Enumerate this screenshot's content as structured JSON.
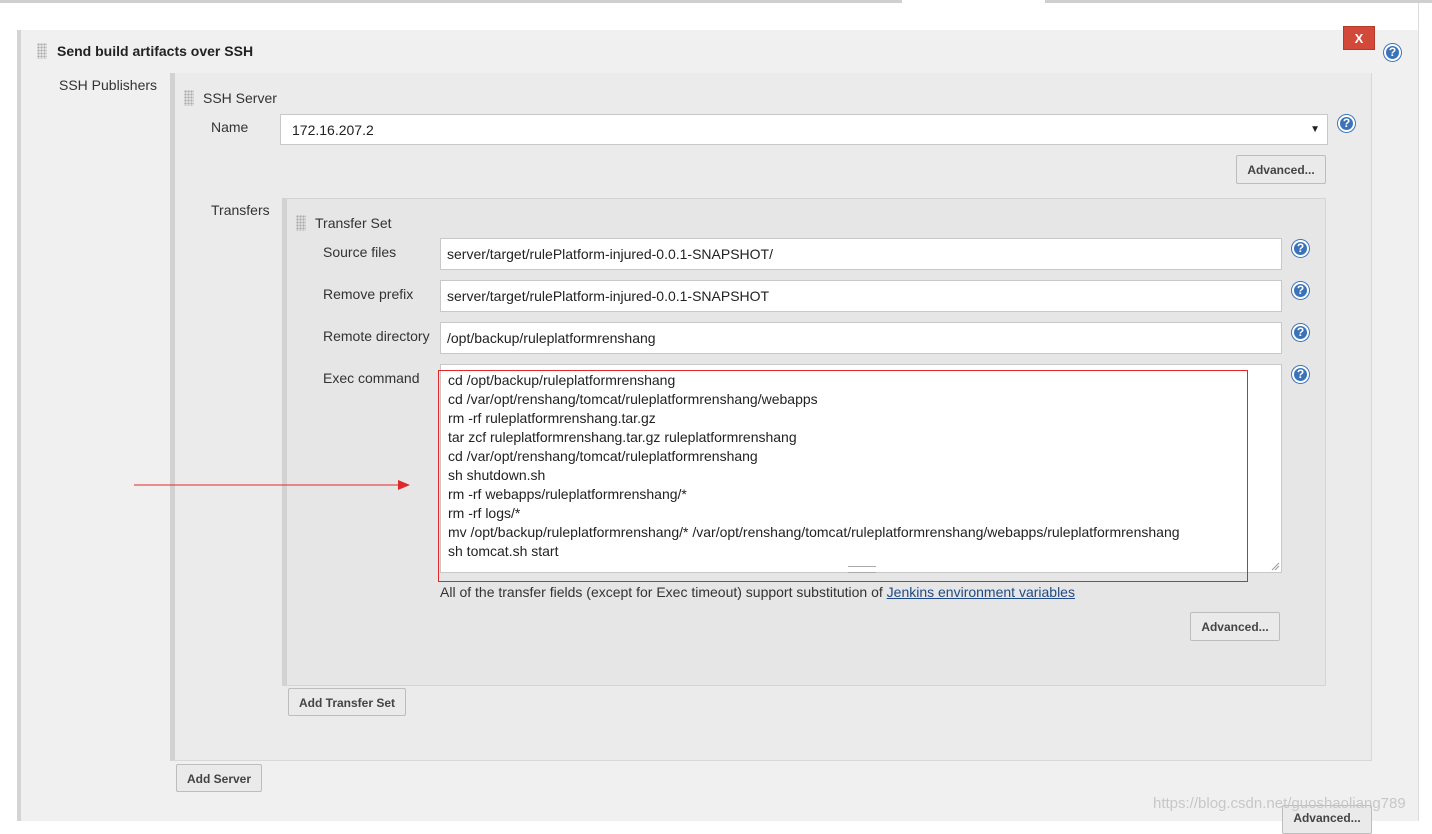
{
  "header": {
    "section_title": "Send build artifacts over SSH",
    "close_label": "X",
    "help_glyph": "?"
  },
  "publishers": {
    "label": "SSH Publishers",
    "server_title": "SSH Server",
    "name_label": "Name",
    "name_value": "172.16.207.2",
    "advanced_label": "Advanced...",
    "transfers_label": "Transfers",
    "add_server_label": "Add Server"
  },
  "transfer_set": {
    "title": "Transfer Set",
    "source_files_label": "Source files",
    "source_files_value": "server/target/rulePlatform-injured-0.0.1-SNAPSHOT/",
    "remove_prefix_label": "Remove prefix",
    "remove_prefix_value": "server/target/rulePlatform-injured-0.0.1-SNAPSHOT",
    "remote_directory_label": "Remote directory",
    "remote_directory_value": "/opt/backup/ruleplatformrenshang",
    "exec_command_label": "Exec command",
    "exec_lines": [
      "cd /opt/backup/ruleplatformrenshang",
      "cd /var/opt/renshang/tomcat/ruleplatformrenshang/webapps",
      "rm -rf ruleplatformrenshang.tar.gz",
      "tar zcf ruleplatformrenshang.tar.gz ruleplatformrenshang",
      "cd /var/opt/renshang/tomcat/ruleplatformrenshang",
      "sh shutdown.sh",
      "rm -rf webapps/ruleplatformrenshang/*",
      "rm -rf logs/*",
      "mv /opt/backup/ruleplatformrenshang/* /var/opt/renshang/tomcat/ruleplatformrenshang/webapps/ruleplatformrenshang",
      "sh tomcat.sh start"
    ],
    "note_text": "All of the transfer fields (except for Exec timeout) support substitution of ",
    "note_link": "Jenkins environment variables",
    "advanced_label": "Advanced...",
    "add_transfer_set_label": "Add Transfer Set"
  },
  "footer": {
    "advanced_label": "Advanced...",
    "watermark": "https://blog.csdn.net/guoshaoliang789"
  },
  "colors": {
    "close_button": "#d24939",
    "help_icon": "#3b73b9",
    "annotation_red": "#e0282a",
    "link": "#204a87"
  }
}
